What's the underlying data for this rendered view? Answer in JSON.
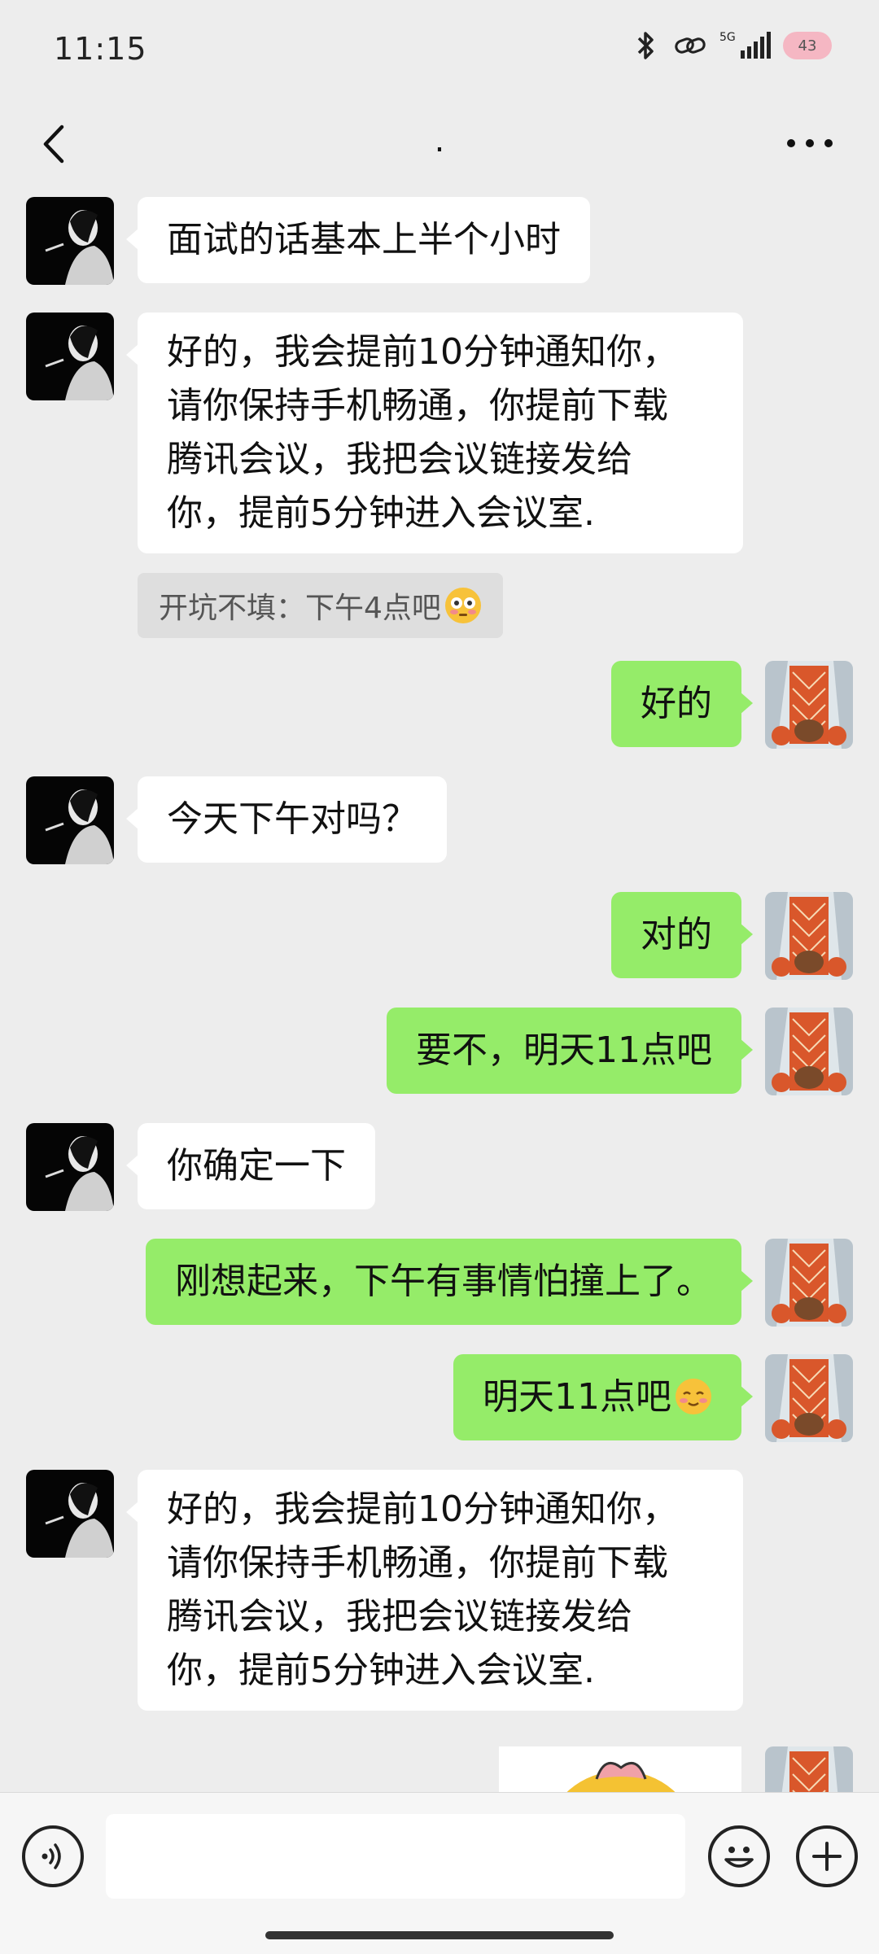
{
  "status_bar": {
    "time": "11:15",
    "network": "5G",
    "battery": "43",
    "icons": [
      "bluetooth-icon",
      "link-icon",
      "signal-icon",
      "battery-icon"
    ]
  },
  "header": {
    "title": ".",
    "icons": [
      "back-arrow-icon",
      "more-icon"
    ]
  },
  "messages": [
    {
      "from": "contact",
      "text": "面试的话基本上半个小时"
    },
    {
      "from": "contact",
      "lines": [
        "好的，我会提前10分钟通知你，",
        "请你保持手机畅通，你提前下载",
        "腾讯会议，我把会议链接发给",
        "你，提前5分钟进入会议室."
      ]
    },
    {
      "type": "quote",
      "text": "开坑不填：下午4点吧",
      "emoji": "flushed-face-icon"
    },
    {
      "from": "me",
      "text": "好的"
    },
    {
      "from": "contact",
      "text": "今天下午对吗？"
    },
    {
      "from": "me",
      "text": "对的"
    },
    {
      "from": "me",
      "text": "要不，明天11点吧"
    },
    {
      "from": "contact",
      "text": "你确定一下"
    },
    {
      "from": "me",
      "text": "刚想起来，下午有事情怕撞上了。"
    },
    {
      "from": "me",
      "text": "明天11点吧",
      "emoji": "smiling-face-icon"
    },
    {
      "from": "contact",
      "lines": [
        "好的，我会提前10分钟通知你，",
        "请你保持手机畅通，你提前下载",
        "腾讯会议，我把会议链接发给",
        "你，提前5分钟进入会议室."
      ]
    },
    {
      "from": "me",
      "type": "sticker",
      "icon": "sticker-cartoon-icon"
    }
  ],
  "input_bar": {
    "placeholder": "",
    "icons": [
      "voice-icon",
      "emoji-icon",
      "plus-icon"
    ]
  },
  "colors": {
    "background": "#ededed",
    "outgoing_bubble": "#95ec69",
    "incoming_bubble": "#ffffff"
  }
}
